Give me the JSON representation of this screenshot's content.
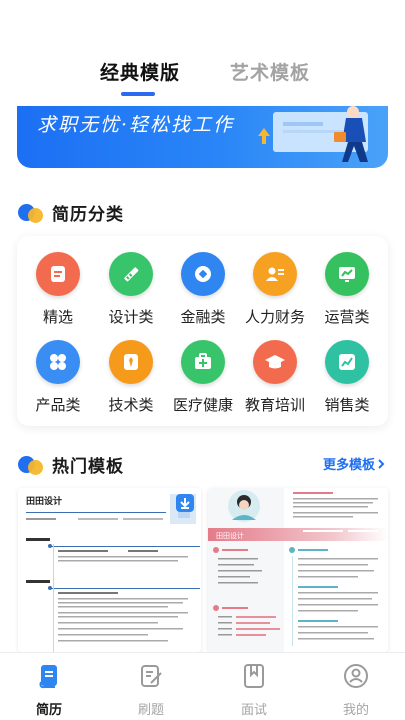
{
  "tabs": {
    "classic": "经典模版",
    "art": "艺术模板"
  },
  "banner": {
    "text": "求职无忧·轻松找工作"
  },
  "category_section": {
    "title": "简历分类"
  },
  "categories": [
    {
      "label": "精选",
      "icon": "document-icon",
      "color": "#f26b4e"
    },
    {
      "label": "设计类",
      "icon": "ruler-pencil-icon",
      "color": "#38c46a"
    },
    {
      "label": "金融类",
      "icon": "coin-icon",
      "color": "#2f86f0"
    },
    {
      "label": "人力财务",
      "icon": "id-card-icon",
      "color": "#f6a122"
    },
    {
      "label": "运营类",
      "icon": "chart-board-icon",
      "color": "#36c160"
    },
    {
      "label": "产品类",
      "icon": "grid-icon",
      "color": "#3a8df3"
    },
    {
      "label": "技术类",
      "icon": "tie-icon",
      "color": "#f69a1c"
    },
    {
      "label": "医疗健康",
      "icon": "medkit-icon",
      "color": "#38c46a"
    },
    {
      "label": "教育培训",
      "icon": "graduation-cap-icon",
      "color": "#f26b4e"
    },
    {
      "label": "销售类",
      "icon": "trend-icon",
      "color": "#2fc2a2"
    }
  ],
  "hot_section": {
    "title": "热门模板",
    "more": "更多模板"
  },
  "templates": [
    {
      "name": "田田设计"
    },
    {
      "name": "田田设计"
    }
  ],
  "nav": [
    {
      "label": "简历",
      "icon": "resume-icon",
      "active": true
    },
    {
      "label": "刷题",
      "icon": "edit-icon",
      "active": false
    },
    {
      "label": "面试",
      "icon": "bookmark-book-icon",
      "active": false
    },
    {
      "label": "我的",
      "icon": "user-circle-icon",
      "active": false
    }
  ],
  "colors": {
    "accent": "#1f6ff0",
    "yellow": "#f7b62b"
  }
}
